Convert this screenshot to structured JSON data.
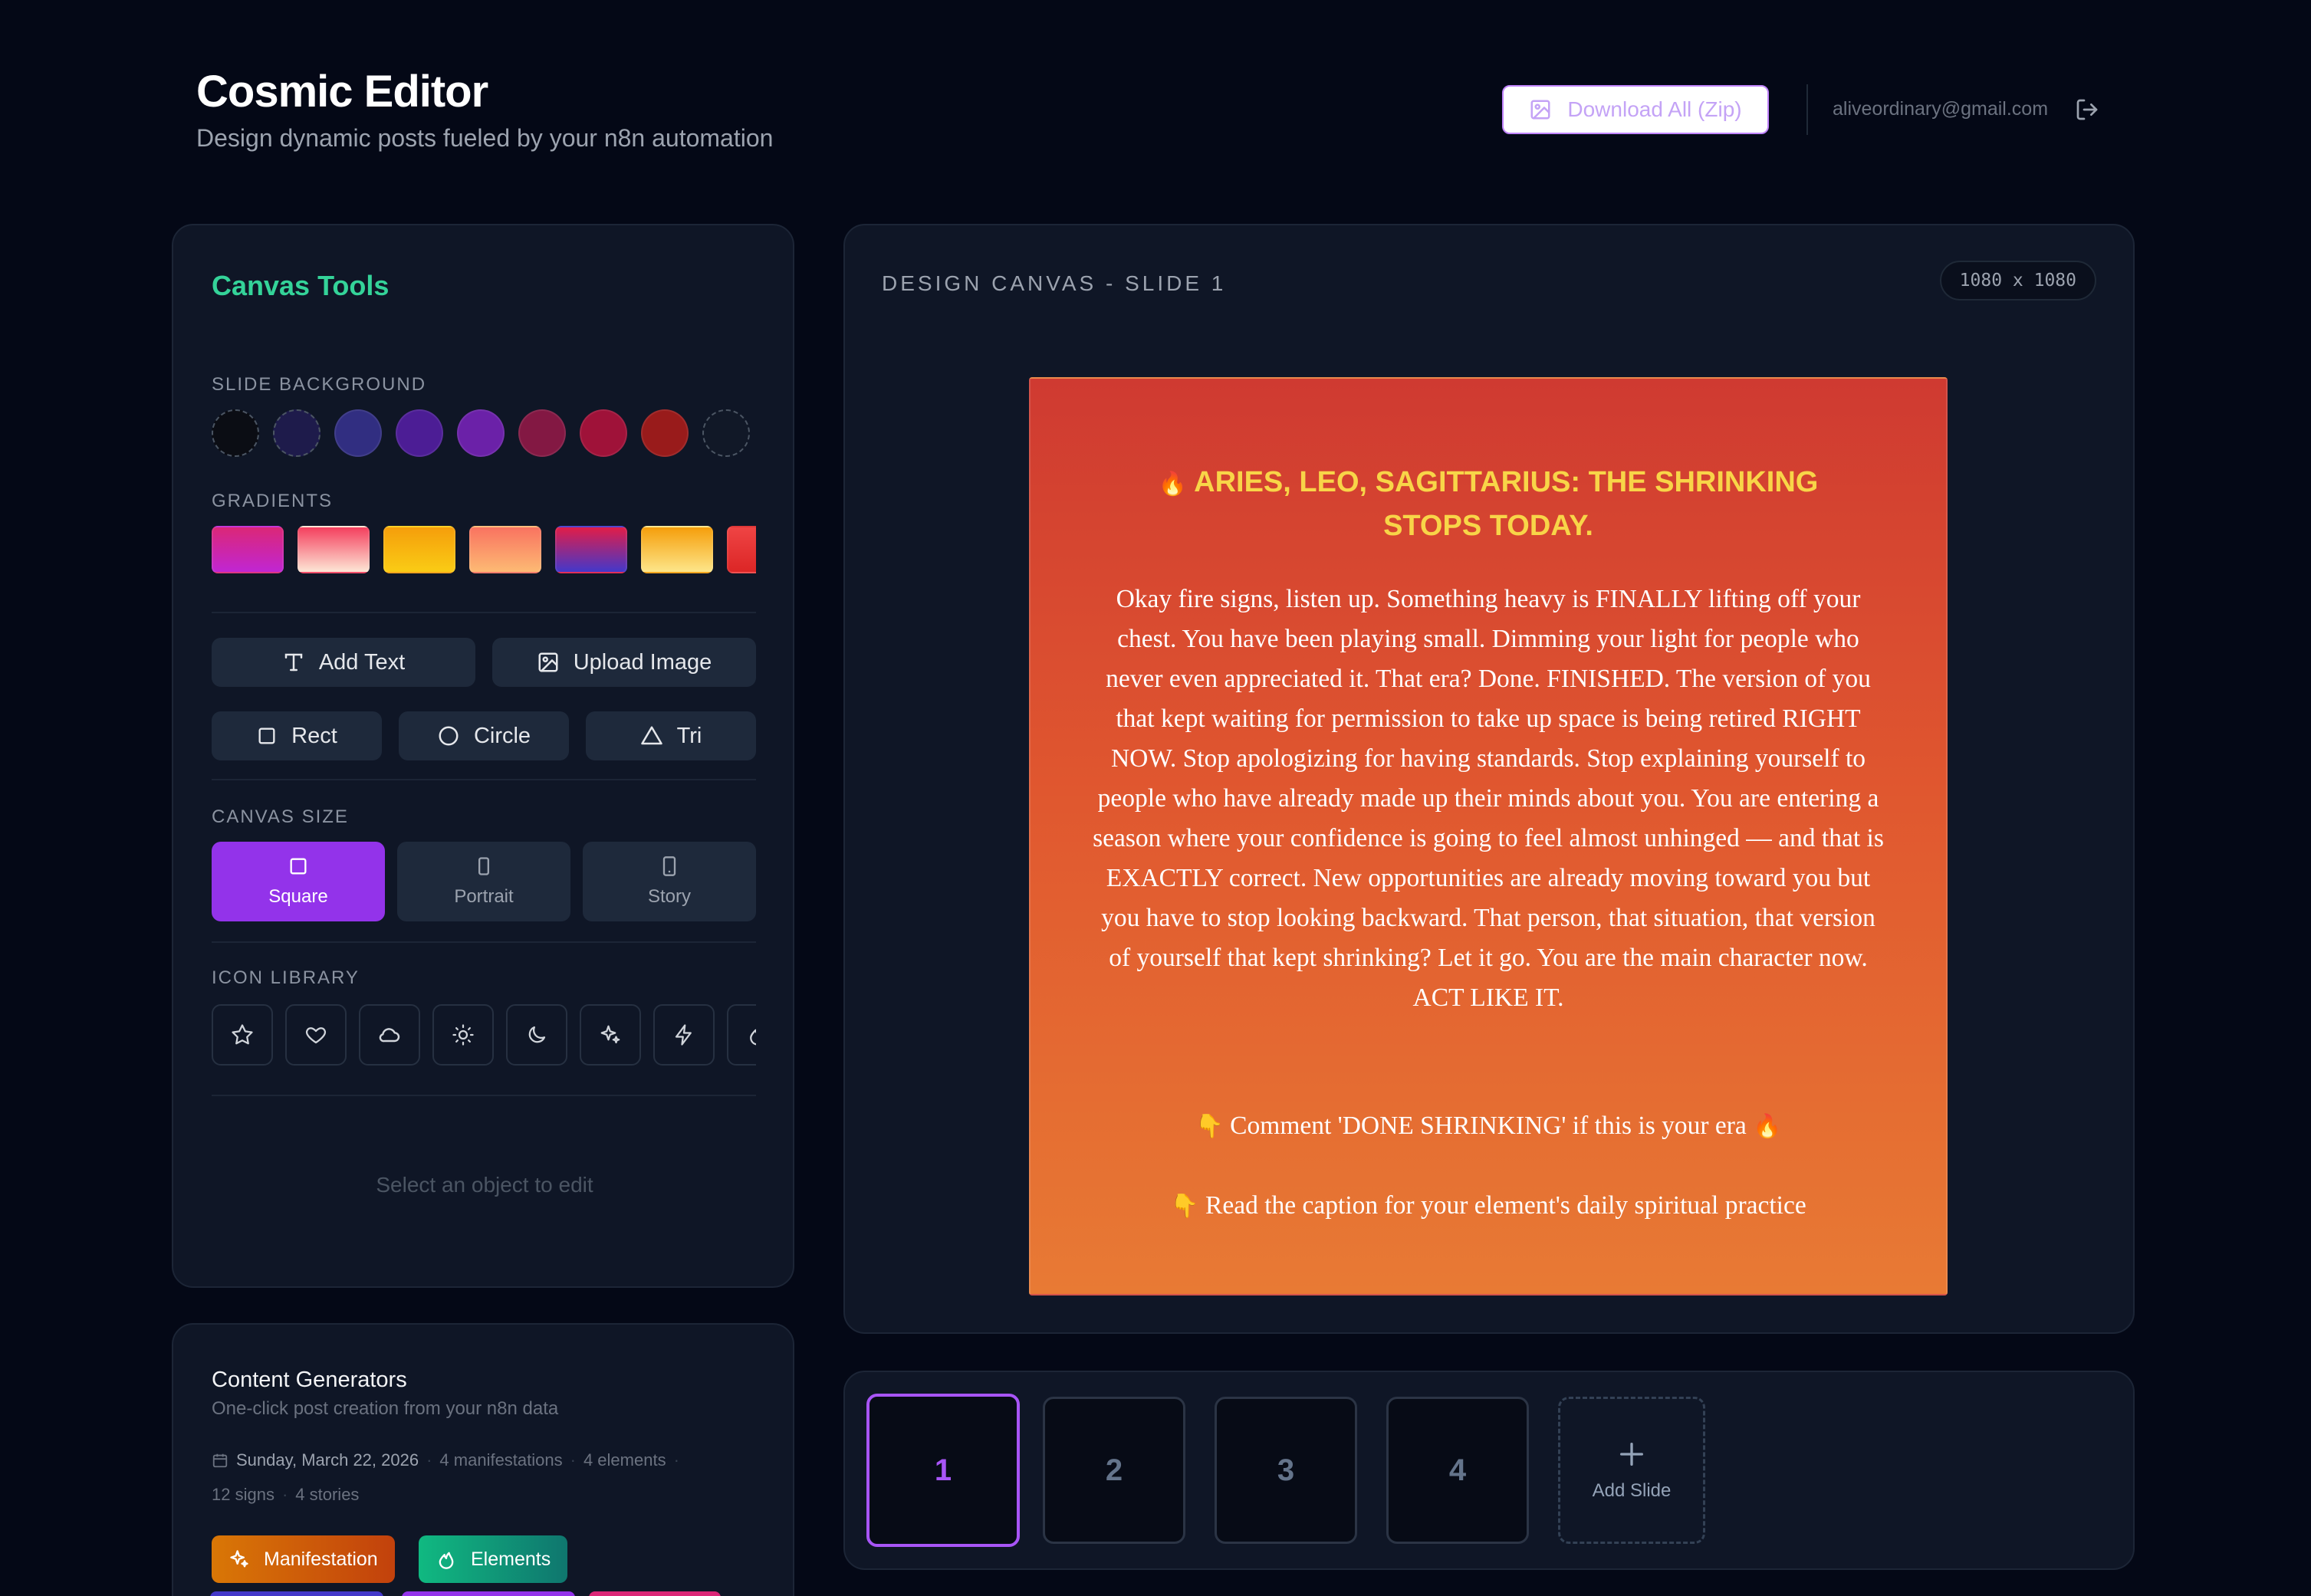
{
  "header": {
    "title": "Cosmic Editor",
    "subtitle": "Design dynamic posts fueled by your n8n automation",
    "download_label": "Download All (Zip)",
    "user_email": "aliveordinary@gmail.com"
  },
  "tools": {
    "title": "Canvas Tools",
    "slide_background_label": "SLIDE BACKGROUND",
    "background_colors": [
      "#0b0d14",
      "#1e1b4b",
      "#312e81",
      "#4c1d95",
      "#6b21a8",
      "#831843",
      "#9f1239",
      "#991b1b",
      "#111827"
    ],
    "gradients_label": "GRADIENTS",
    "gradients": [
      [
        "#db2777",
        "#c026d3"
      ],
      [
        "#f43f5e",
        "#fde7d6"
      ],
      [
        "#f59e0b",
        "#facc15"
      ],
      [
        "#f97360",
        "#fdba74"
      ],
      [
        "#e11d48",
        "#4338ca"
      ],
      [
        "#f59e0b",
        "#fde68a"
      ],
      [
        "#ef4444",
        "#dc2626"
      ]
    ],
    "add_text_label": "Add Text",
    "upload_image_label": "Upload Image",
    "rect_label": "Rect",
    "circle_label": "Circle",
    "tri_label": "Tri",
    "canvas_size_label": "CANVAS SIZE",
    "sizes": [
      {
        "label": "Square",
        "active": true
      },
      {
        "label": "Portrait",
        "active": false
      },
      {
        "label": "Story",
        "active": false
      }
    ],
    "icon_library_label": "ICON LIBRARY",
    "icons": [
      "star-icon",
      "heart-icon",
      "cloud-icon",
      "sun-icon",
      "moon-icon",
      "sparkles-icon",
      "zap-icon",
      "flame-icon"
    ],
    "select_hint": "Select an object to edit"
  },
  "generators": {
    "title": "Content Generators",
    "subtitle": "One-click post creation from your n8n data",
    "date": "Sunday, March 22, 2026",
    "manifestations": "4 manifestations",
    "elements": "4 elements",
    "signs": "12 signs",
    "stories": "4 stories",
    "manifestation_btn": "Manifestation",
    "elements_btn": "Elements"
  },
  "canvas": {
    "label": "DESIGN CANVAS - SLIDE 1",
    "dimensions": "1080 x 1080",
    "slide": {
      "heading": "ARIES, LEO, SAGITTARIUS: THE SHRINKING STOPS TODAY.",
      "body": "Okay fire signs, listen up. Something heavy is FINALLY lifting off your chest. You have been playing small. Dimming your light for people who never even appreciated it. That era? Done. FINISHED. The version of you that kept waiting for permission to take up space is being retired RIGHT NOW. Stop apologizing for having standards. Stop explaining yourself to people who have already made up their minds about you. You are entering a season where your confidence is going to feel almost unhinged — and that is EXACTLY correct. New opportunities are already moving toward you but you have to stop looking backward. That person, that situation, that version of yourself that kept shrinking? Let it go. You are the main character now. ACT LIKE IT.",
      "cta1": "Comment 'DONE SHRINKING' if this is your era",
      "cta2": "Read the caption for your element's daily spiritual practice",
      "fire_emoji": "🔥",
      "point_emoji": "👇"
    }
  },
  "slides": {
    "items": [
      "1",
      "2",
      "3",
      "4"
    ],
    "add_label": "Add Slide",
    "add_symbol": "+"
  }
}
